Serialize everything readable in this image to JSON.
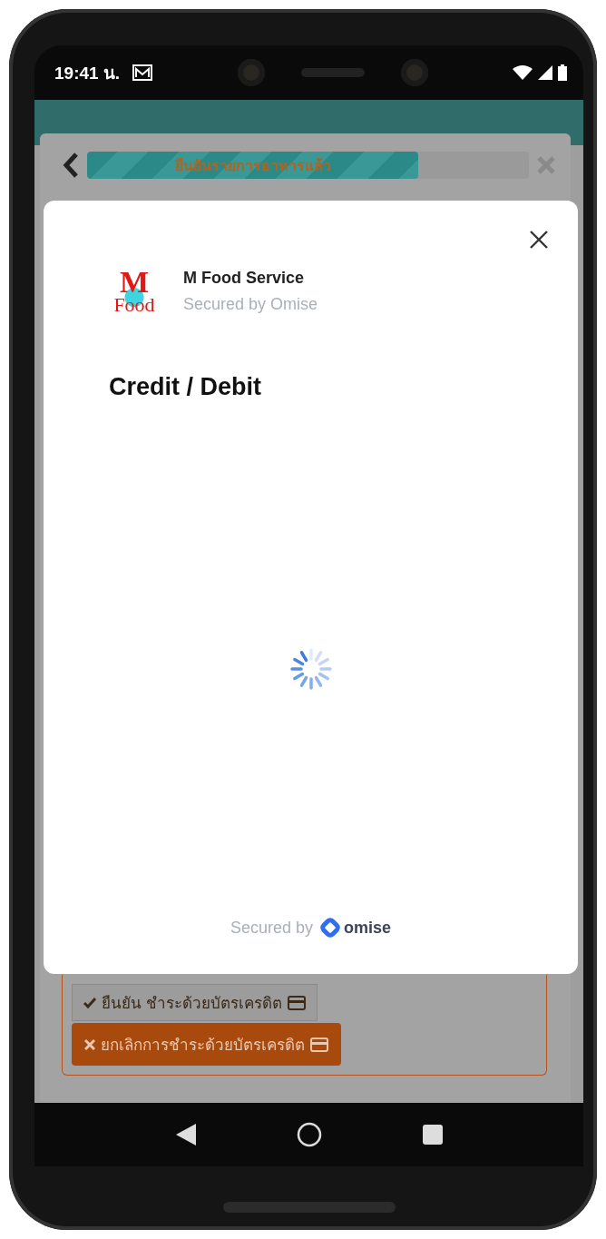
{
  "status_bar": {
    "time": "19:41 น."
  },
  "background_page": {
    "progress": {
      "label": "ยืนยันรายการอาหารแล้ว",
      "level": 0.75
    },
    "buttons": [
      {
        "kind": "confirm",
        "label": "ยืนยัน ชำระด้วยบัตรเครดิต"
      },
      {
        "kind": "cancel",
        "label": "ยกเลิกการชำระด้วยบัตรเครดิต"
      }
    ]
  },
  "payment_modal": {
    "logo": {
      "line_1": "M",
      "line_2": "Food"
    },
    "merchant_name": "M Food Service",
    "merchant_subtitle": "Secured by Omise",
    "title": "Credit / Debit",
    "footer": {
      "text": "Secured by",
      "brand": "omise"
    }
  }
}
